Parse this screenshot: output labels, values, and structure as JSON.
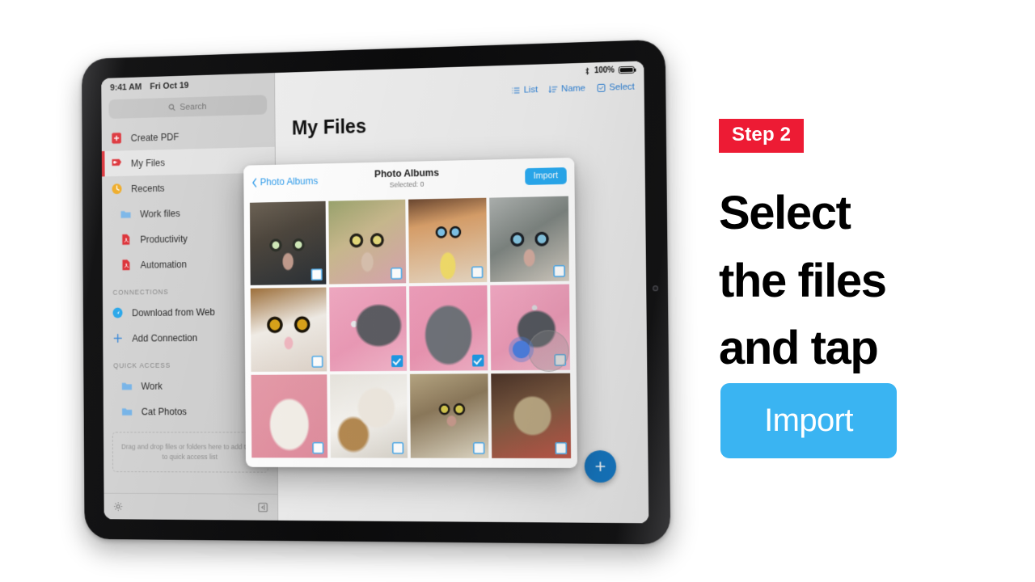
{
  "tablet": {
    "status_bar": {
      "time": "9:41 AM",
      "date": "Fri Oct 19",
      "battery_text": "100%",
      "bluetooth_icon": "bluetooth-icon",
      "battery_icon": "battery-icon"
    },
    "sidebar": {
      "search_placeholder": "Search",
      "search_icon": "search-icon",
      "items": [
        {
          "label": "Create PDF",
          "icon": "create-pdf-icon",
          "selected": false
        },
        {
          "label": "My Files",
          "icon": "adobe-files-icon",
          "selected": true
        },
        {
          "label": "Recents",
          "icon": "clock-icon",
          "selected": false
        },
        {
          "label": "Work files",
          "icon": "folder-icon",
          "selected": false,
          "sub": true
        },
        {
          "label": "Productivity",
          "icon": "pdf-file-icon",
          "selected": false,
          "sub": true
        },
        {
          "label": "Automation",
          "icon": "pdf-file-icon",
          "selected": false,
          "sub": true
        }
      ],
      "connections_header": "CONNECTIONS",
      "connections": [
        {
          "label": "Download from Web",
          "icon": "download-web-icon"
        },
        {
          "label": "Add Connection",
          "icon": "plus-icon"
        }
      ],
      "quick_access_header": "QUICK ACCESS",
      "quick_access": [
        {
          "label": "Work",
          "icon": "folder-icon"
        },
        {
          "label": "Cat Photos",
          "icon": "folder-icon"
        }
      ],
      "dropzone_text": "Drag and drop files or folders here to add them to quick access list",
      "settings_icon": "gear-icon",
      "collapse_icon": "collapse-sidebar-icon"
    },
    "content": {
      "page_title": "My Files",
      "toolbar": [
        {
          "label": "List",
          "icon": "list-view-icon"
        },
        {
          "label": "Name",
          "icon": "sort-name-icon"
        },
        {
          "label": "Select",
          "icon": "select-checkbox-icon"
        }
      ],
      "fab_icon": "plus-icon"
    },
    "modal": {
      "back_label": "Photo Albums",
      "back_icon": "chevron-left-icon",
      "title": "Photo Albums",
      "subtitle": "Selected: 0",
      "import_label": "Import",
      "photos": [
        {
          "name": "tabby-closeup",
          "selected": false
        },
        {
          "name": "abyssinian-kitten",
          "selected": false
        },
        {
          "name": "orange-white-kitten",
          "selected": false
        },
        {
          "name": "silver-tabby",
          "selected": false
        },
        {
          "name": "exotic-shorthair",
          "selected": false
        },
        {
          "name": "grey-cat-lying-pink",
          "selected": true
        },
        {
          "name": "russian-blue-face",
          "selected": true
        },
        {
          "name": "grey-cat-standing",
          "selected": false
        },
        {
          "name": "birman-pink-bg",
          "selected": false
        },
        {
          "name": "himalayan-persian",
          "selected": false
        },
        {
          "name": "brown-tabby-lying",
          "selected": false
        },
        {
          "name": "scottish-fold-kitten",
          "selected": false
        }
      ]
    }
  },
  "panel": {
    "step_label": "Step 2",
    "headline_lines": [
      "Select",
      "the files",
      "and tap"
    ],
    "import_label": "Import"
  },
  "colors": {
    "accent_blue": "#3ab4f2",
    "step_red": "#ed1b34",
    "selection_blue": "#1e9ae5",
    "adobe_red": "#d91f26"
  }
}
